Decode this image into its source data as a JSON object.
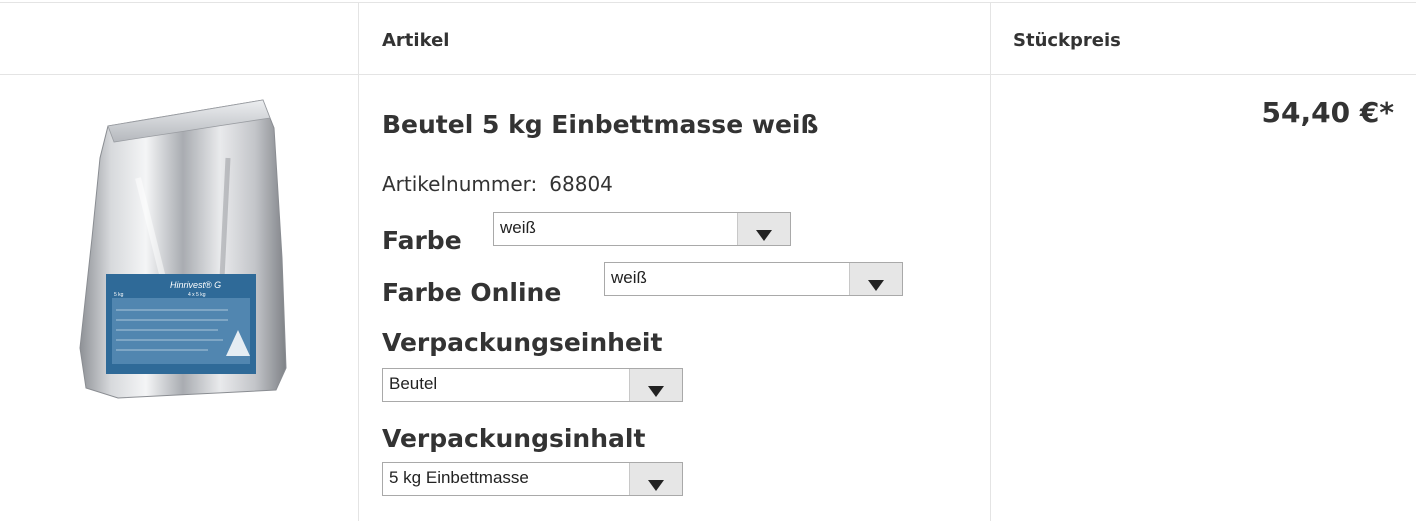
{
  "table": {
    "header": {
      "artikel": "Artikel",
      "stueckpreis": "Stückpreis"
    }
  },
  "product": {
    "image_icon": "foil-bag-product-image",
    "image_text": {
      "brand": "Hinrivest® G",
      "size1": "5 kg",
      "size2": "4 x 5 kg"
    },
    "title": "Beutel 5 kg Einbettmasse weiß",
    "artikelnummer_label": "Artikelnummer:",
    "artikelnummer_value": "68804",
    "price": "54,40 €*",
    "options": {
      "farbe": {
        "label": "Farbe",
        "value": "weiß"
      },
      "farbe_online": {
        "label": "Farbe Online",
        "value": "weiß"
      },
      "verpackungseinheit": {
        "label": "Verpackungseinheit",
        "value": "Beutel"
      },
      "verpackungsinhalt": {
        "label": "Verpackungsinhalt",
        "value": "5 kg Einbettmasse"
      }
    }
  },
  "colors": {
    "text": "#333333",
    "grid": "#e4e4e4",
    "select_button": "#e6e6e6",
    "label_blue": "#3a6f9e"
  }
}
